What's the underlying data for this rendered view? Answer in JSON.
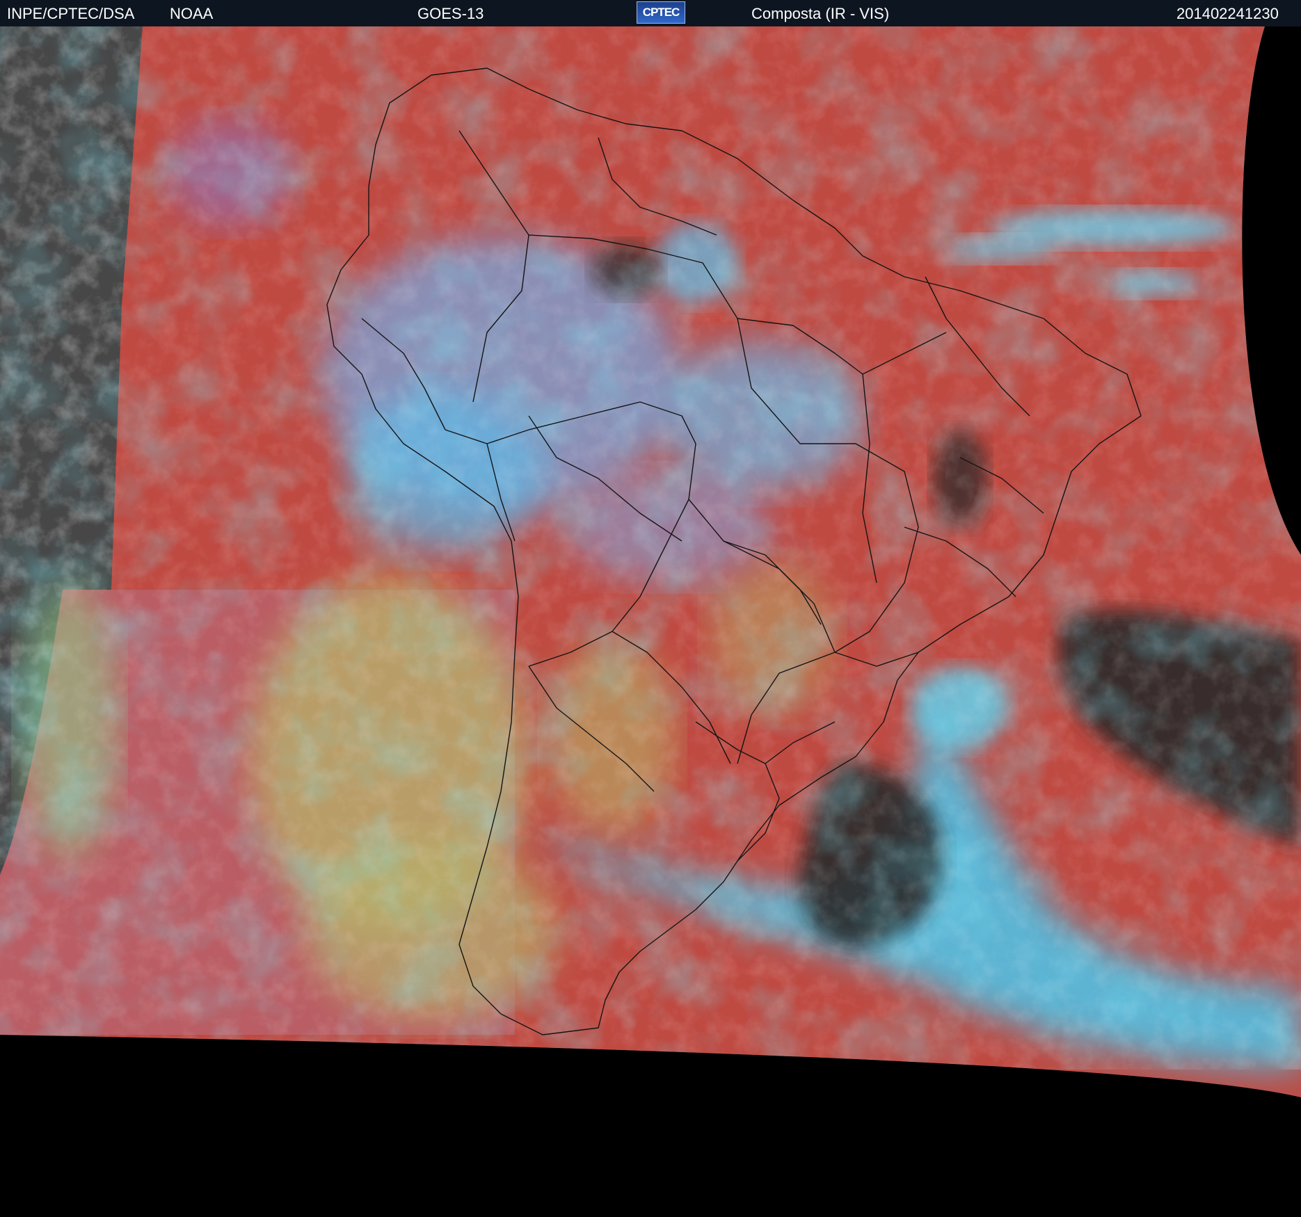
{
  "header": {
    "agency": "INPE/CPTEC/DSA",
    "partner": "NOAA",
    "satellite": "GOES-13",
    "logo_text": "CPTEC",
    "product": "Composta (IR - VIS)",
    "timestamp": "201402241230"
  },
  "colors": {
    "header_bg": "#0d1620",
    "land_red": "#c0473f",
    "cloud_cyan": "#46c8ea",
    "cloud_blue": "#7fa8e0",
    "low_cloud_yellow": "#b8b56a",
    "clear_ocean_dark": "#2a2a2a",
    "off_disk_black": "#000000",
    "west_grey": "#4a4a4a"
  }
}
